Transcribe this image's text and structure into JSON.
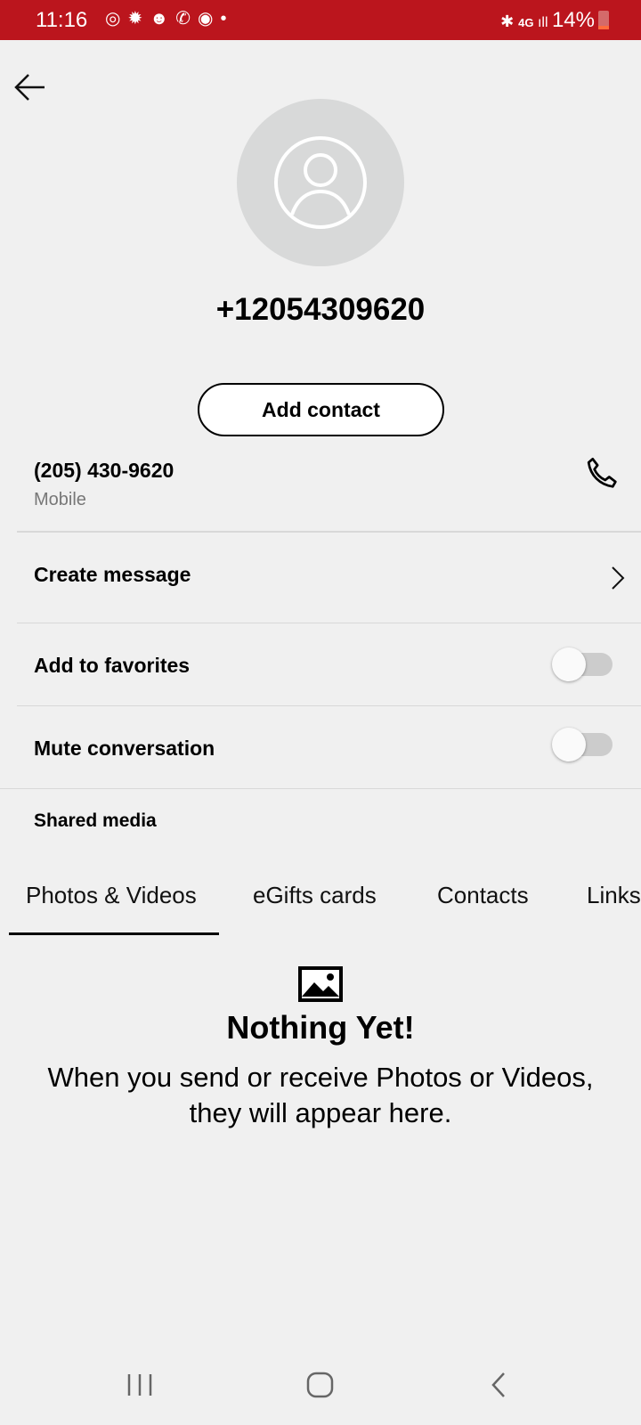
{
  "status_bar": {
    "time": "11:16",
    "notification_icons": [
      "sync-icon",
      "gear-icon",
      "chat-icon",
      "wifi-call-icon",
      "chrome-icon",
      "dot-icon"
    ],
    "network": "4G",
    "battery": "14%"
  },
  "contact": {
    "title": "+12054309620",
    "add_contact_label": "Add contact",
    "phone": "(205) 430-9620",
    "phone_type": "Mobile"
  },
  "actions": {
    "create_message": "Create message",
    "add_to_favorites": "Add to favorites",
    "favorites_on": false,
    "mute_conversation": "Mute conversation",
    "mute_on": false
  },
  "shared_media": {
    "heading": "Shared media",
    "tabs": [
      "Photos & Videos",
      "eGifts cards",
      "Contacts",
      "Links"
    ],
    "active_tab": 0,
    "empty_title": "Nothing Yet!",
    "empty_line1": "When you send or receive Photos or Videos,",
    "empty_line2": "they will appear here."
  }
}
